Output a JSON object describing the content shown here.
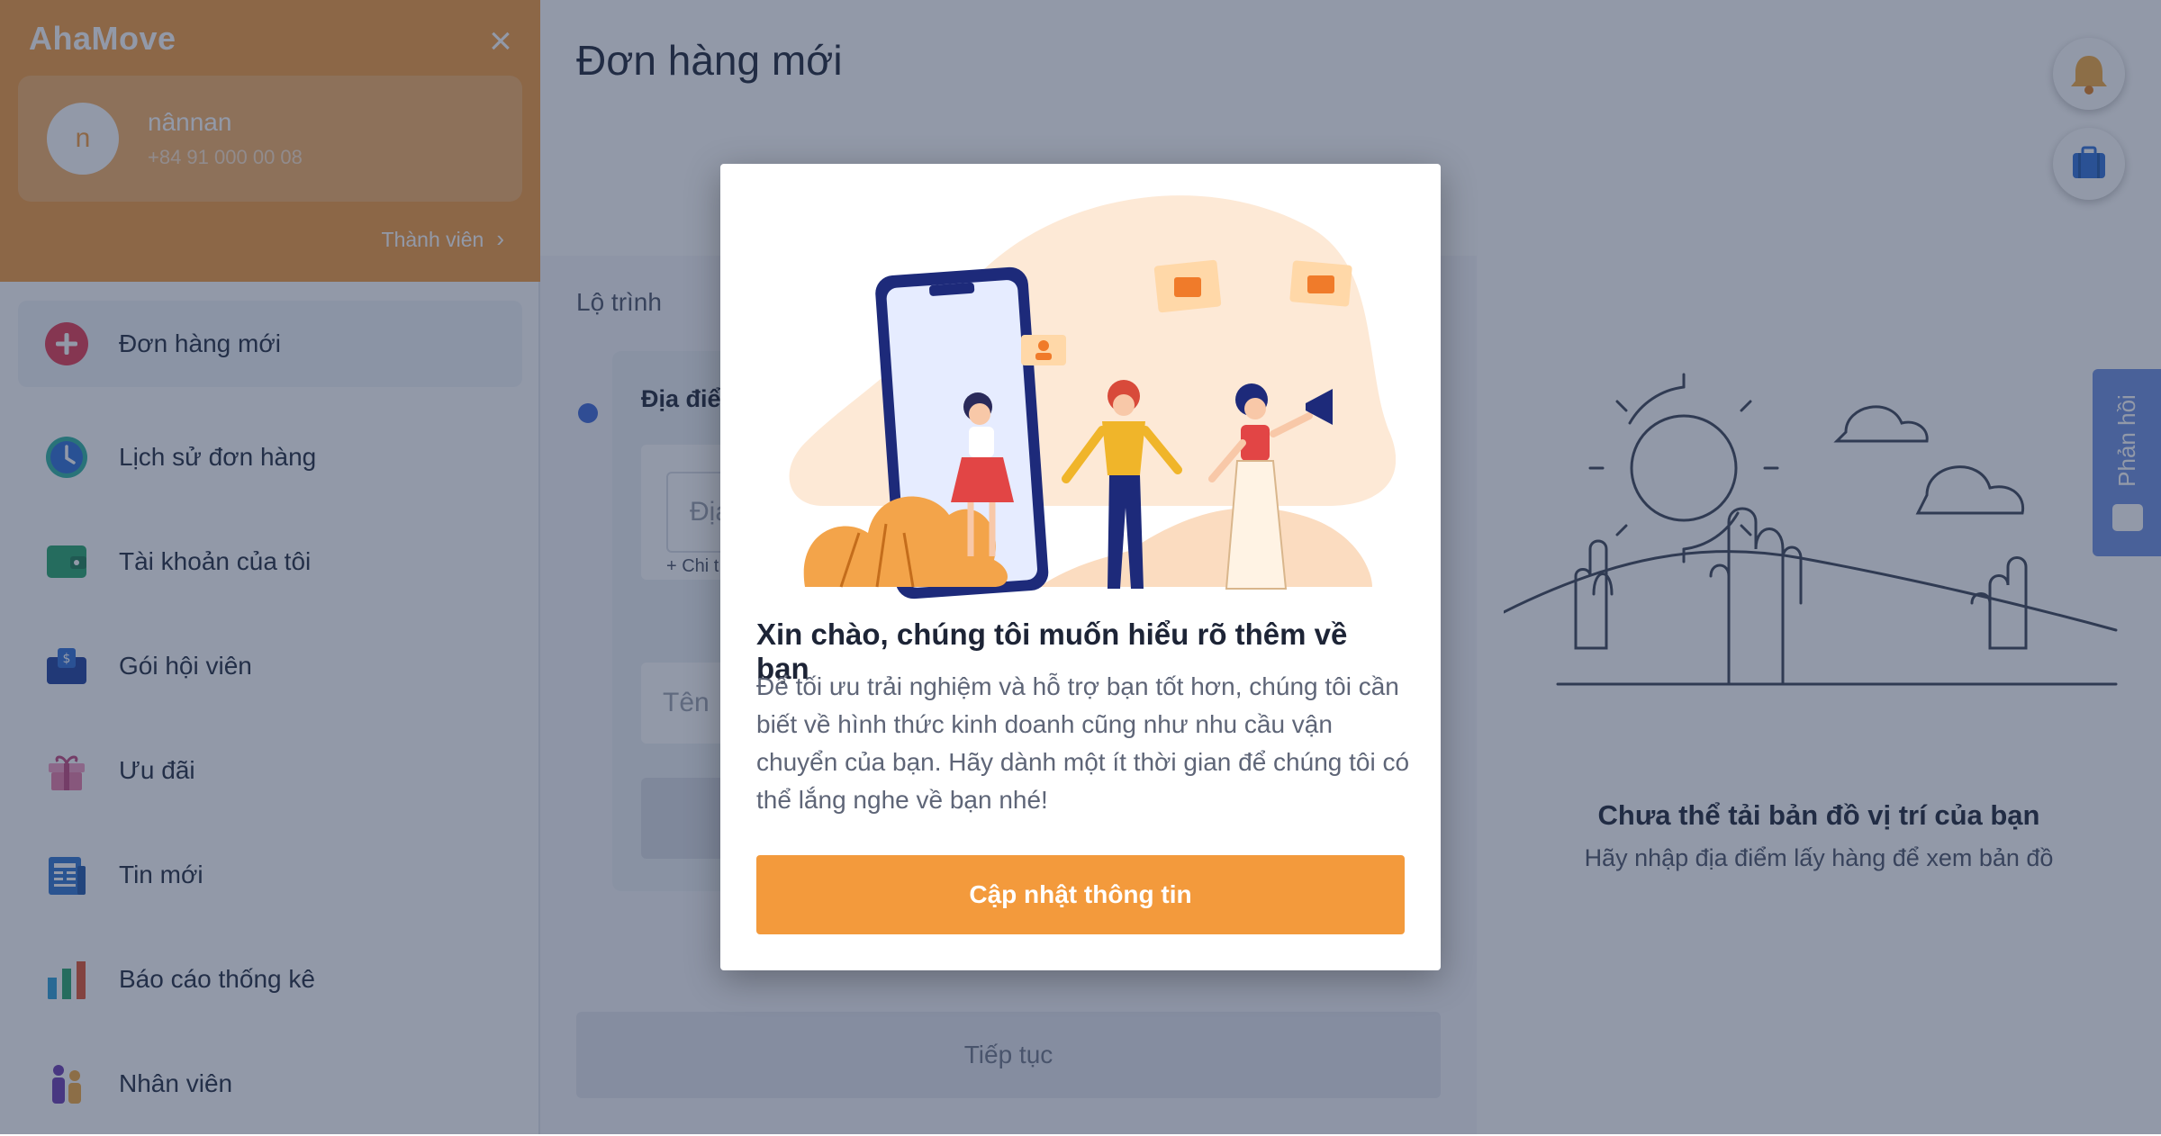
{
  "app": {
    "brand": "AhaMove"
  },
  "user": {
    "initial": "n",
    "name": "nânnan",
    "phone": "+84 91 000 00 08",
    "member_link": "Thành viên"
  },
  "menu": [
    {
      "label": "Đơn hàng mới",
      "icon": "plus-circle-icon",
      "color": "#e53950"
    },
    {
      "label": "Lịch sử đơn hàng",
      "icon": "clock-icon",
      "color": "#2d9bd6"
    },
    {
      "label": "Tài khoản của tôi",
      "icon": "wallet-icon",
      "color": "#25a46b"
    },
    {
      "label": "Gói hội viên",
      "icon": "membership-card-icon",
      "color": "#1d3f9c"
    },
    {
      "label": "Ưu đãi",
      "icon": "gift-icon",
      "color": "#e87ba7"
    },
    {
      "label": "Tin mới",
      "icon": "newspaper-icon",
      "color": "#2f74d0"
    },
    {
      "label": "Báo cáo thống kê",
      "icon": "bar-chart-icon",
      "color": "#e0532f"
    },
    {
      "label": "Nhân viên",
      "icon": "staff-icon",
      "color": "#6b3ab0"
    }
  ],
  "main": {
    "title": "Đơn hàng mới",
    "section_label": "Lộ trình",
    "route_head": "Địa điể",
    "address_placeholder": "Địa",
    "address_detail": "+ Chi t",
    "name_placeholder": "Tên",
    "continue_label": "Tiếp tục"
  },
  "map": {
    "title": "Chưa thể tải bản đồ vị trí của bạn",
    "subtitle": "Hãy nhập địa điểm lấy hàng để xem bản đồ",
    "feedback_label": "Phản hồi"
  },
  "modal": {
    "title": "Xin chào, chúng tôi muốn hiểu rõ thêm về bạn",
    "body": "Để tối ưu trải nghiệm và hỗ trợ bạn tốt hơn, chúng tôi cần biết về hình thức kinh doanh cũng như nhu cầu vận chuyển của bạn. Hãy dành một ít thời gian để chúng tôi có thể lắng nghe về bạn nhé!",
    "button_label": "Cập nhật thông tin"
  },
  "colors": {
    "accent": "#f39a3c",
    "overlay": "#263452",
    "feedback": "#6c8fe0"
  }
}
